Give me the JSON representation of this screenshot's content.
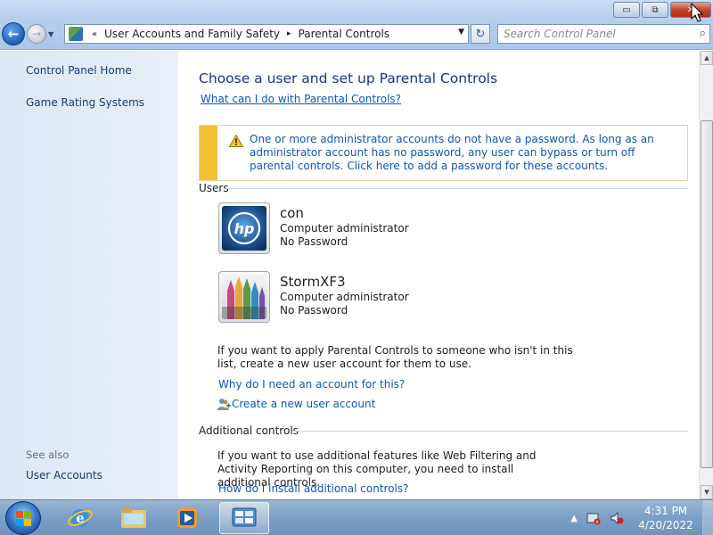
{
  "window": {
    "minimize_glyph": "▭",
    "maximize_glyph": "⧉",
    "close_glyph": "✕"
  },
  "nav": {
    "back_glyph": "←",
    "forward_glyph": "→",
    "breadcrumb_prefix": "«",
    "breadcrumb": [
      "User Accounts and Family Safety",
      "Parental Controls"
    ],
    "breadcrumb_sep": "▸",
    "refresh_glyph": "↻",
    "search_placeholder": "Search Control Panel"
  },
  "sidebar": {
    "items": [
      {
        "label": "Control Panel Home"
      },
      {
        "label": "Game Rating Systems"
      }
    ],
    "see_also_label": "See also",
    "see_also_items": [
      {
        "label": "User Accounts"
      }
    ]
  },
  "main": {
    "title": "Choose a user and set up Parental Controls",
    "help_link": "What can I do with Parental Controls?",
    "warning_text": "One or more administrator accounts do not have a password. As long as an administrator account has no password, any user can bypass or turn off parental controls. Click here to add a password for these accounts.",
    "users_heading": "Users",
    "users": [
      {
        "name": "con",
        "role": "Computer administrator",
        "password_status": "No Password",
        "picture": "hp-logo"
      },
      {
        "name": "StormXF3",
        "role": "Computer administrator",
        "password_status": "No Password",
        "picture": "crayons"
      }
    ],
    "add_user_text": "If you want to apply Parental Controls to someone who isn't in this list, create a new user account for them to use.",
    "why_account_link": "Why do I need an account for this?",
    "create_account_link": "Create a new user account",
    "additional_heading": "Additional controls",
    "additional_text": "If you want to use additional features like Web Filtering and Activity Reporting on this computer, you need to install additional controls.",
    "install_link": "How do I install additional controls?"
  },
  "help_glyph": "?",
  "taskbar": {
    "apps": [
      {
        "name": "internet-explorer"
      },
      {
        "name": "windows-explorer"
      },
      {
        "name": "media-player"
      },
      {
        "name": "control-panel",
        "active": true
      }
    ],
    "tray_chevron": "▲",
    "clock_time": "4:31 PM",
    "clock_date": "4/20/2022"
  }
}
